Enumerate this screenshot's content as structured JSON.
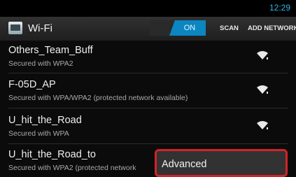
{
  "status_bar": {
    "clock": "12:29"
  },
  "action_bar": {
    "title": "Wi-Fi",
    "toggle_label": "ON",
    "scan_label": "SCAN",
    "add_network_label": "ADD NETWORK",
    "icon": "wifi-settings-icon"
  },
  "networks": [
    {
      "name": "Others_Team_Buff",
      "security": "Secured with WPA2",
      "icon": "wifi-signal-icon"
    },
    {
      "name": "F-05D_AP",
      "security": "Secured with WPA/WPA2 (protected network available)",
      "icon": "wifi-signal-icon"
    },
    {
      "name": "U_hit_the_Road",
      "security": "Secured with WPA",
      "icon": "wifi-signal-icon"
    },
    {
      "name": "U_hit_the_Road_to",
      "security": "Secured with WPA2 (protected network",
      "icon": "wifi-signal-icon"
    }
  ],
  "menu": {
    "advanced_label": "Advanced"
  },
  "colors": {
    "accent": "#33b5e5",
    "toggle_on": "#0b86c1",
    "highlight": "#d2232a"
  }
}
